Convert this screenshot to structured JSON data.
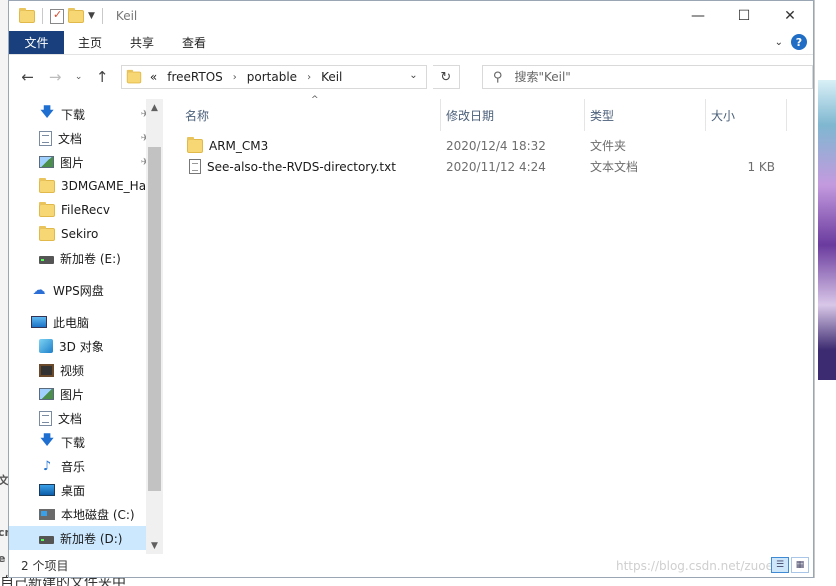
{
  "window": {
    "title": "Keil",
    "controls": {
      "minimize": "—",
      "maximize": "☐",
      "close": "✕"
    }
  },
  "ribbon": {
    "tabs": [
      "文件",
      "主页",
      "共享",
      "查看"
    ],
    "help": "?"
  },
  "nav": {
    "back": "←",
    "forward": "→",
    "recent": "⌄",
    "up": "↑",
    "breadcrumb": [
      "«",
      "freeRTOS",
      "portable",
      "Keil"
    ],
    "breadcrumb_sep": "›",
    "refresh": "↻"
  },
  "search": {
    "placeholder": "搜索\"Keil\""
  },
  "sidebar": {
    "quick_access": [
      {
        "label": "下载",
        "icon": "download-arrow-icon",
        "pinned": true
      },
      {
        "label": "文档",
        "icon": "document-icon",
        "pinned": true
      },
      {
        "label": "图片",
        "icon": "pictures-icon",
        "pinned": true
      },
      {
        "label": "3DMGAME_Ha",
        "icon": "folder-icon",
        "pinned": false
      },
      {
        "label": "FileRecv",
        "icon": "folder-icon",
        "pinned": false
      },
      {
        "label": "Sekiro",
        "icon": "folder-icon",
        "pinned": false
      },
      {
        "label": "新加卷 (E:)",
        "icon": "drive-icon",
        "pinned": false
      }
    ],
    "wps": "WPS网盘",
    "this_pc": "此电脑",
    "pc_items": [
      {
        "label": "3D 对象",
        "icon": "3d-objects-icon"
      },
      {
        "label": "视频",
        "icon": "video-icon"
      },
      {
        "label": "图片",
        "icon": "pictures-icon"
      },
      {
        "label": "文档",
        "icon": "document-icon"
      },
      {
        "label": "下载",
        "icon": "download-arrow-icon"
      },
      {
        "label": "音乐",
        "icon": "music-icon"
      },
      {
        "label": "桌面",
        "icon": "desktop-icon"
      },
      {
        "label": "本地磁盘 (C:)",
        "icon": "windows-drive-icon"
      },
      {
        "label": "新加卷 (D:)",
        "icon": "drive-icon",
        "selected": true
      }
    ]
  },
  "columns": {
    "name": "名称",
    "modified": "修改日期",
    "type": "类型",
    "size": "大小"
  },
  "files": [
    {
      "name": "ARM_CM3",
      "modified": "2020/12/4 18:32",
      "type": "文件夹",
      "size": "",
      "icon": "folder-icon"
    },
    {
      "name": "See-also-the-RVDS-directory.txt",
      "modified": "2020/11/12 4:24",
      "type": "文本文档",
      "size": "1 KB",
      "icon": "text-file-icon"
    }
  ],
  "status": {
    "count": "2 个项目"
  },
  "background": {
    "bottom_text": "自己新建的文件夹中",
    "watermark": "https://blog.csdn.net/zuoe"
  }
}
